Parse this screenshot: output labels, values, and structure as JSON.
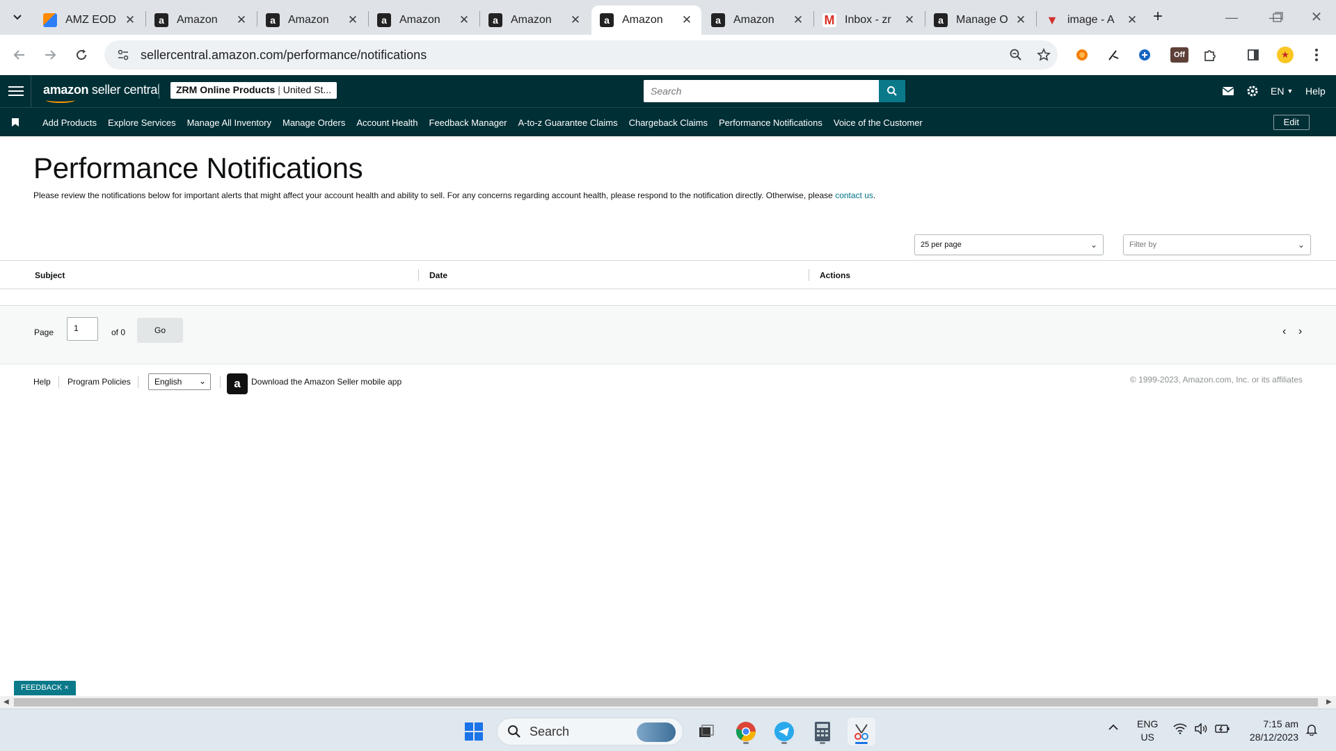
{
  "browser": {
    "tabs": [
      {
        "title": "AMZ EOD",
        "icon": "doc"
      },
      {
        "title": "Amazon",
        "icon": "amazon"
      },
      {
        "title": "Amazon",
        "icon": "amazon"
      },
      {
        "title": "Amazon",
        "icon": "amazon"
      },
      {
        "title": "Amazon",
        "icon": "amazon"
      },
      {
        "title": "Amazon",
        "icon": "amazon",
        "active": true
      },
      {
        "title": "Amazon",
        "icon": "amazon"
      },
      {
        "title": "Inbox - zr",
        "icon": "gmail"
      },
      {
        "title": "Manage O",
        "icon": "amazon"
      },
      {
        "title": "image - A",
        "icon": "triangle"
      }
    ],
    "url": "sellercentral.amazon.com/performance/notifications"
  },
  "header": {
    "logo_bold": "amazon",
    "logo_thin": "seller central",
    "account_bold": "ZRM Online Products",
    "account_region": "United St...",
    "search_placeholder": "Search",
    "language": "EN",
    "help": "Help",
    "brand_color": "#002f36",
    "accent_color": "#0a7a8a"
  },
  "nav": {
    "items": [
      "Add Products",
      "Explore Services",
      "Manage All Inventory",
      "Manage Orders",
      "Account Health",
      "Feedback Manager",
      "A-to-z Guarantee Claims",
      "Chargeback Claims",
      "Performance Notifications",
      "Voice of the Customer"
    ],
    "edit": "Edit"
  },
  "page": {
    "title": "Performance Notifications",
    "description": "Please review the notifications below for important alerts that might affect your account health and ability to sell. For any concerns regarding account health, please respond to the notification directly. Otherwise, please",
    "contact_link": "contact us",
    "per_page": "25 per page",
    "filter_placeholder": "Filter by"
  },
  "table": {
    "columns": [
      "Subject",
      "Date",
      "Actions"
    ],
    "rows": []
  },
  "pager": {
    "page_label": "Page",
    "current_page": "1",
    "of_label": "of 0",
    "go": "Go"
  },
  "footer": {
    "help": "Help",
    "program_policies": "Program Policies",
    "language": "English",
    "app_text": "Download the Amazon Seller mobile app",
    "copyright": "© 1999-2023, Amazon.com, Inc. or its affiliates"
  },
  "feedback": "FEEDBACK ×",
  "taskbar": {
    "search": "Search",
    "lang_top": "ENG",
    "lang_bottom": "US",
    "time": "7:15 am",
    "date": "28/12/2023"
  }
}
